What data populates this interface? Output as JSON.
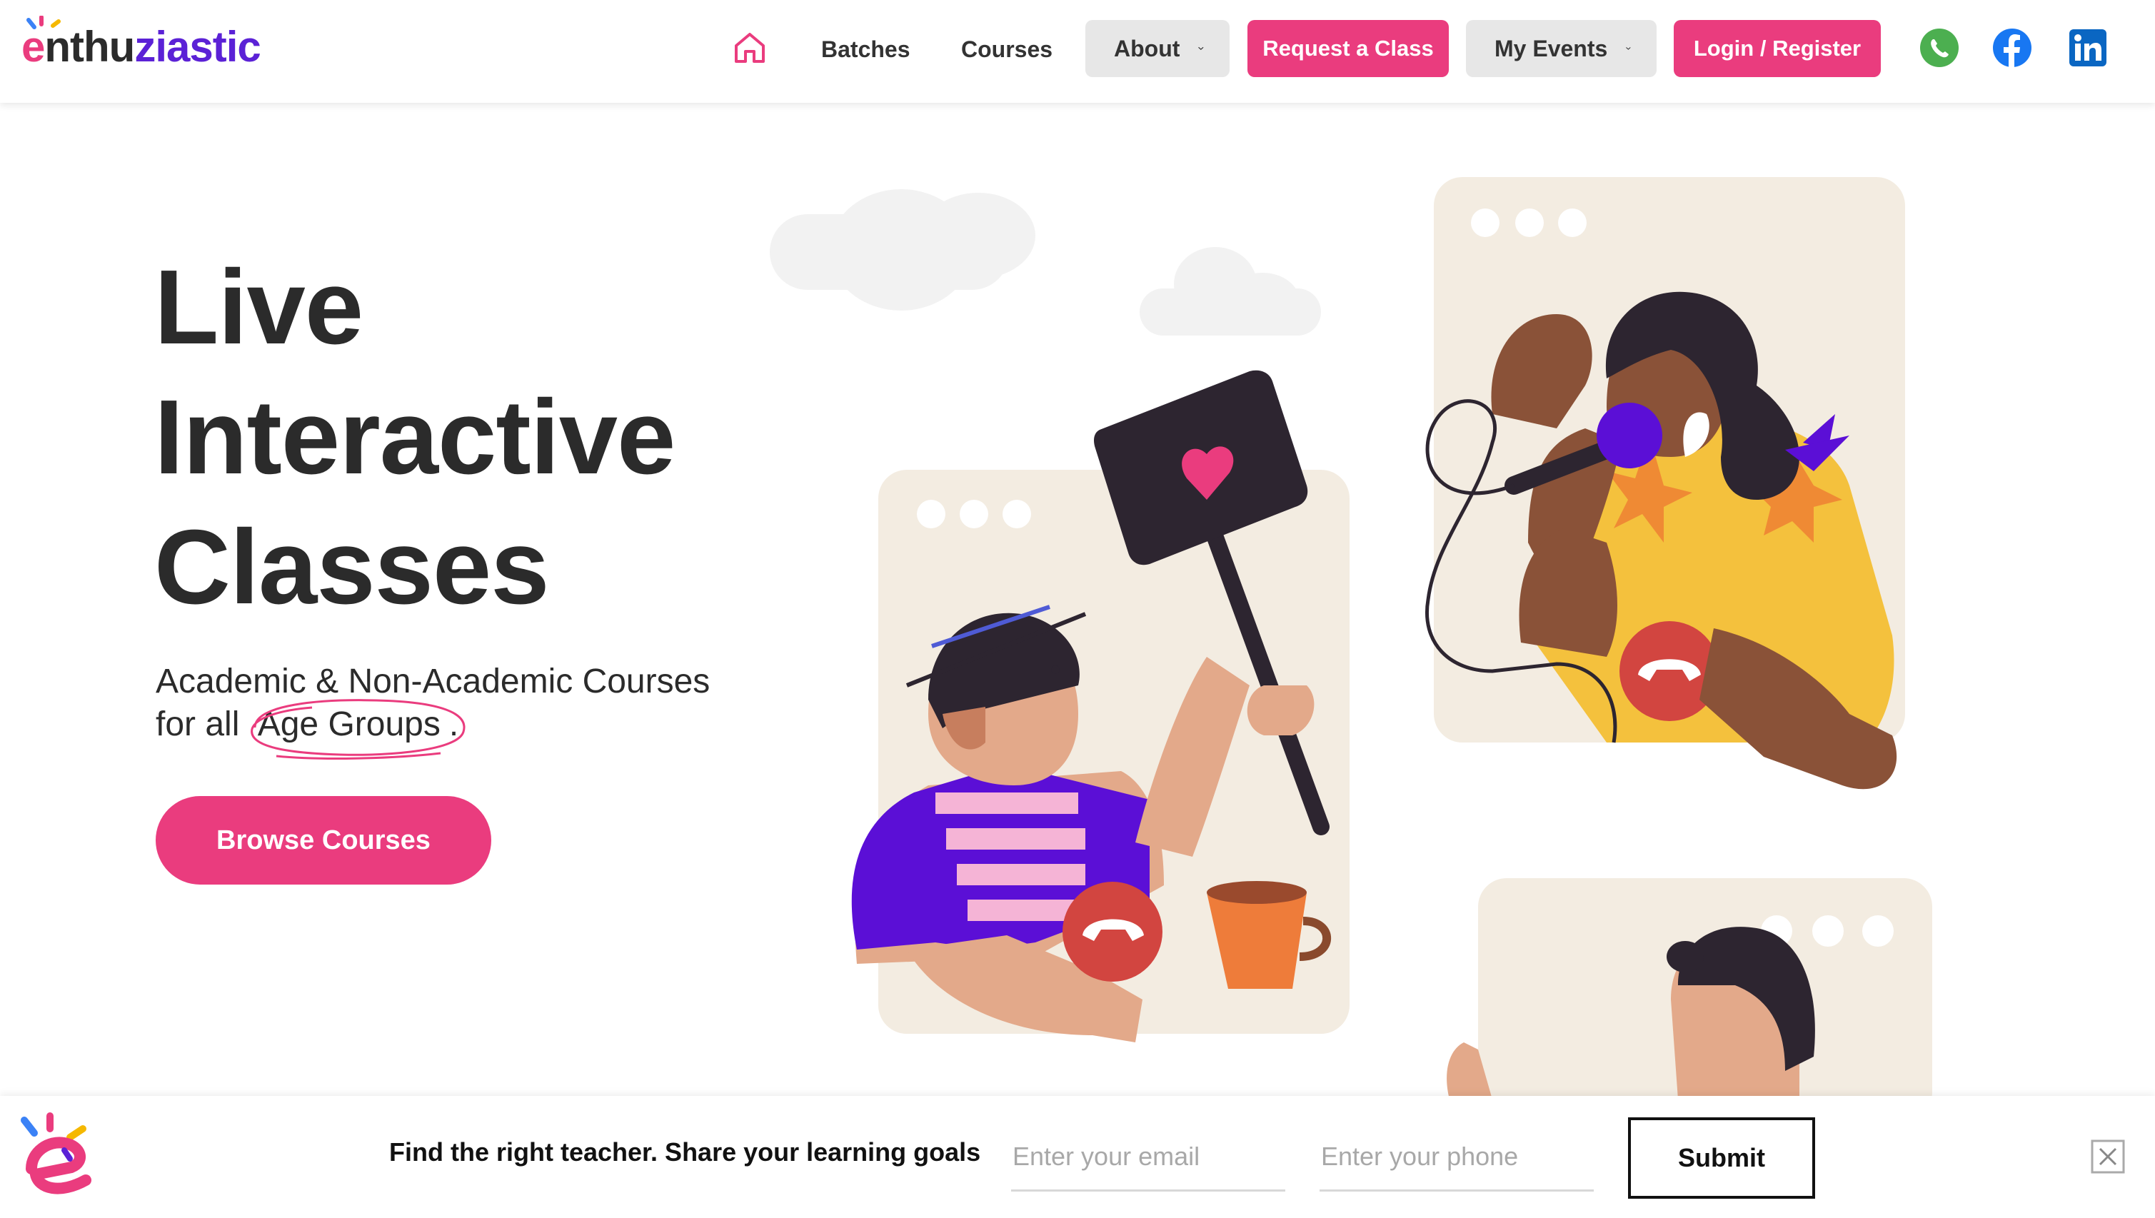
{
  "brand": {
    "logo_part1": "e",
    "logo_part2": "nthu",
    "logo_part3": "ziastic",
    "primary_color": "#ea3c7e",
    "secondary_color": "#5b21d6"
  },
  "nav": {
    "home_icon": "home-icon",
    "batches": "Batches",
    "courses": "Courses",
    "about": "About",
    "request_class": "Request a Class",
    "my_events": "My Events",
    "login_register": "Login / Register",
    "social": [
      "whatsapp-icon",
      "facebook-icon",
      "linkedin-icon"
    ]
  },
  "hero": {
    "title_line1": "Live",
    "title_line2": "Interactive",
    "title_line3": "Classes",
    "subtitle_line1": "Academic & Non-Academic Courses",
    "subtitle_prefix": "for all ",
    "subtitle_highlight": "Age Groups",
    "subtitle_suffix": ".",
    "cta": "Browse Courses"
  },
  "lead_form": {
    "prompt": "Find the right teacher. Share your learning goals",
    "email_placeholder": "Enter your email",
    "phone_placeholder": "Enter your phone",
    "submit": "Submit",
    "close_icon": "close-icon"
  }
}
